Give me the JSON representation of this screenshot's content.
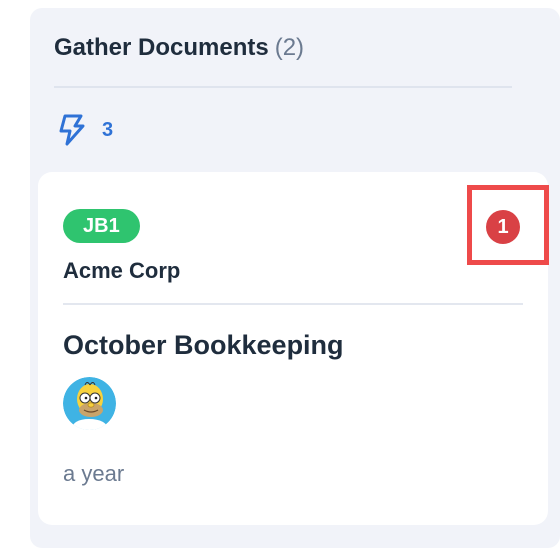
{
  "column": {
    "title": "Gather Documents",
    "count": "(2)",
    "automation": {
      "icon": "lightning-bolt-icon",
      "count": "3"
    }
  },
  "card": {
    "job_code": "JB1",
    "client": "Acme Corp",
    "title": "October Bookkeeping",
    "assignee_avatar": "homer-avatar",
    "time_ago": "a year",
    "notification_count": "1"
  },
  "colors": {
    "column_bg": "#f1f3f9",
    "accent_blue": "#2f72d6",
    "badge_green": "#2fc46f",
    "alert_red": "#d94145",
    "highlight_red": "#ee4a4a"
  }
}
